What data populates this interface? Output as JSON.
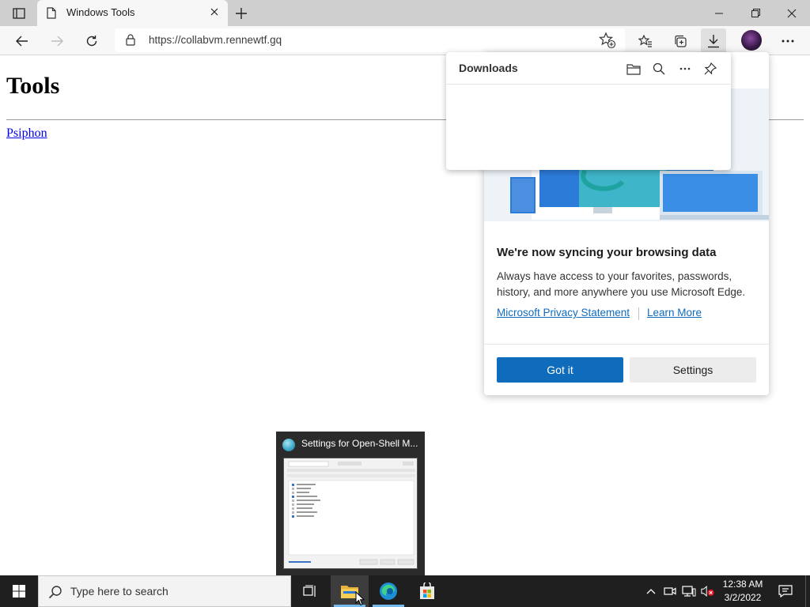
{
  "browser": {
    "tab": {
      "title": "Windows Tools"
    },
    "address": {
      "url": "https://collabvm.rennewtf.gq"
    }
  },
  "page": {
    "heading": "Tools",
    "links": [
      "Psiphon"
    ]
  },
  "downloads_flyout": {
    "title": "Downloads"
  },
  "sync_panel": {
    "title": "We're now syncing your browsing data",
    "body": "Always have access to your favorites, passwords, history, and more anywhere you use Microsoft Edge.",
    "privacy_link": "Microsoft Privacy Statement",
    "learn_more_link": "Learn More",
    "primary_button": "Got it",
    "secondary_button": "Settings"
  },
  "taskbar_preview": {
    "title": "Settings for Open-Shell M..."
  },
  "taskbar": {
    "search_placeholder": "Type here to search",
    "clock_time": "12:38 AM",
    "clock_date": "3/2/2022"
  },
  "colors": {
    "accent": "#0f6cbd",
    "taskbar": "#1f1f1f",
    "tab_strip": "#cfcfcf"
  }
}
